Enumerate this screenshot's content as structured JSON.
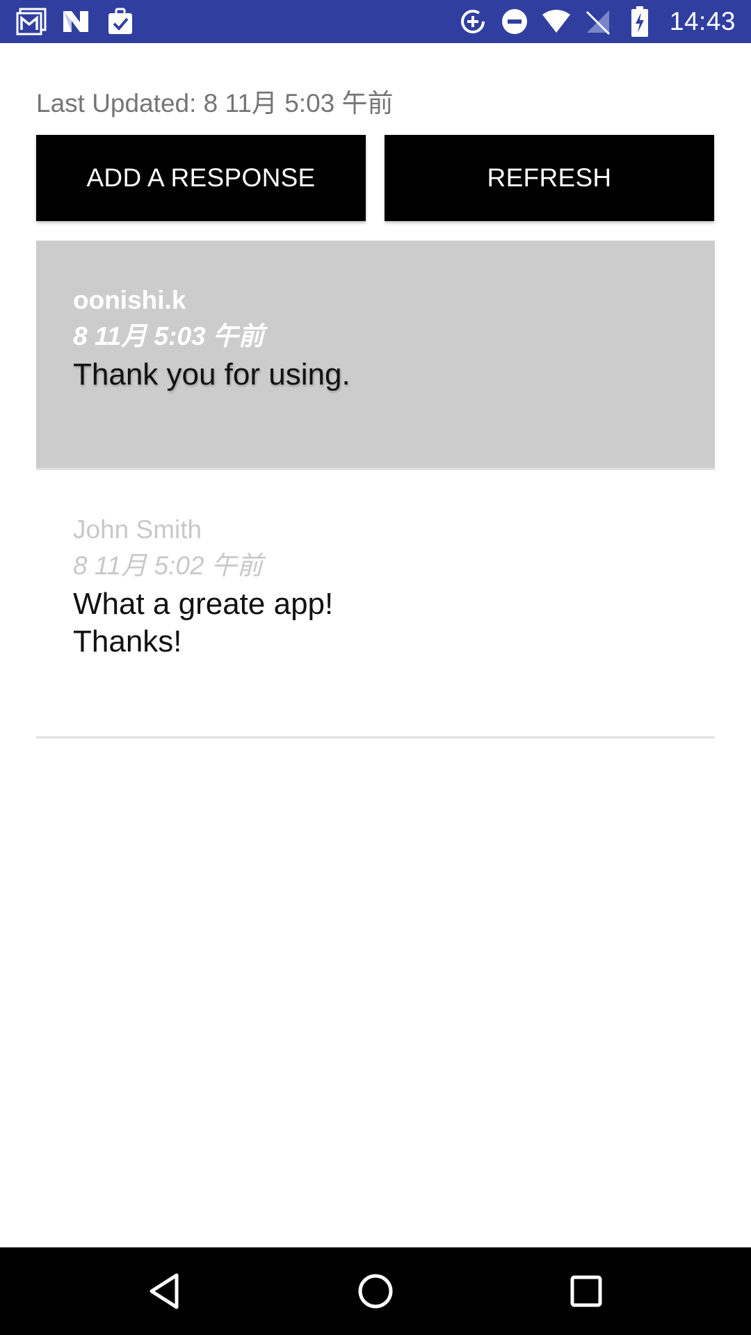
{
  "status_bar": {
    "time": "14:43",
    "left_icons": [
      "gmail-icon",
      "n-app-icon",
      "clipboard-check-icon"
    ],
    "right_icons": [
      "data-saver-icon",
      "do-not-disturb-icon",
      "wifi-icon",
      "no-signal-icon",
      "battery-charging-icon"
    ],
    "background": "#303f9f"
  },
  "header": {
    "last_updated": "Last Updated: 8 11月 5:03 午前"
  },
  "buttons": {
    "add_response": "ADD A RESPONSE",
    "refresh": "REFRESH"
  },
  "responses": [
    {
      "author": "oonishi.k",
      "date": "8 11月 5:03 午前",
      "body": "Thank you for using.",
      "selected": true
    },
    {
      "author": "John Smith",
      "date": "8 11月 5:02 午前",
      "body": "What a greate app!\nThanks!",
      "selected": false
    }
  ],
  "nav_bar": {
    "icons": [
      "back-icon",
      "home-icon",
      "recents-icon"
    ]
  },
  "colors": {
    "accent": "#303f9f",
    "button": "#000000",
    "selected_item": "#cccccc"
  }
}
